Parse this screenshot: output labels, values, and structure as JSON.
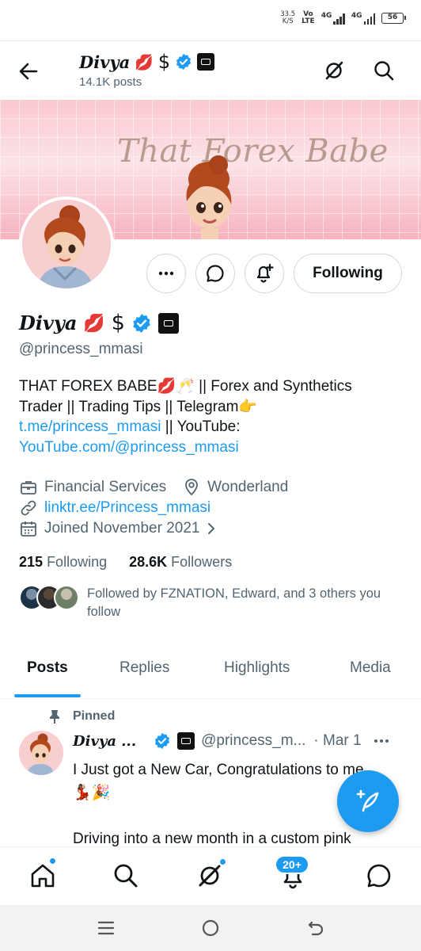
{
  "status_bar": {
    "speed_value": "33.5",
    "speed_unit": "K/S",
    "net_vo": "Vo",
    "net_lte": "LTE",
    "net_4g_1": "4G",
    "net_4g_2": "4G",
    "battery": "56"
  },
  "topbar": {
    "name": "Divya",
    "name_emoji": "💋",
    "name_dollar": "$",
    "posts_count": "14.1K posts"
  },
  "banner": {
    "text": "That Forex Babe"
  },
  "actions": {
    "following_label": "Following"
  },
  "profile": {
    "name": "Divya",
    "name_emoji": "💋",
    "name_dollar": "$",
    "handle": "@princess_mmasi",
    "bio_line1": "THAT FOREX BABE💋🥂 || Forex and Synthetics Trader || Trading Tips || Telegram👉",
    "bio_link1": "t.me/princess_mmasi",
    "bio_mid": " || YouTube:",
    "bio_link2": "YouTube.com/@princess_mmasi",
    "category": "Financial Services",
    "location": "Wonderland",
    "website": "linktr.ee/Princess_mmasi",
    "joined": "Joined November 2021",
    "following_count": "215",
    "following_label": "Following",
    "followers_count": "28.6K",
    "followers_label": "Followers",
    "followed_by": "Followed by FZNATION, Edward, and 3 others you follow"
  },
  "tabs": [
    {
      "label": "Posts"
    },
    {
      "label": "Replies"
    },
    {
      "label": "Highlights"
    },
    {
      "label": "Media"
    }
  ],
  "post": {
    "pinned_label": "Pinned",
    "name": "Divya ...",
    "handle": "@princess_m...",
    "date": "· Mar 1",
    "line1": "I Just got a New Car, Congratulations to me",
    "line2": "💃🏾🎉",
    "line3": "Driving into a new month in a custom pink"
  },
  "bottom_nav": {
    "notifications_badge": "20+"
  },
  "colors": {
    "accent": "#1d9bf0",
    "text": "#0f1419",
    "muted": "#536471",
    "border": "#cfd9de",
    "banner_pink": "#f8dfe3"
  },
  "icons": [
    "back-arrow-icon",
    "grok-icon",
    "search-icon",
    "more-icon",
    "message-icon",
    "bell-plus-icon",
    "verified-icon",
    "square-badge-icon",
    "briefcase-icon",
    "location-icon",
    "link-icon",
    "calendar-icon",
    "chevron-right-icon",
    "pin-icon",
    "feather-icon",
    "home-icon",
    "bell-icon",
    "chat-icon"
  ]
}
